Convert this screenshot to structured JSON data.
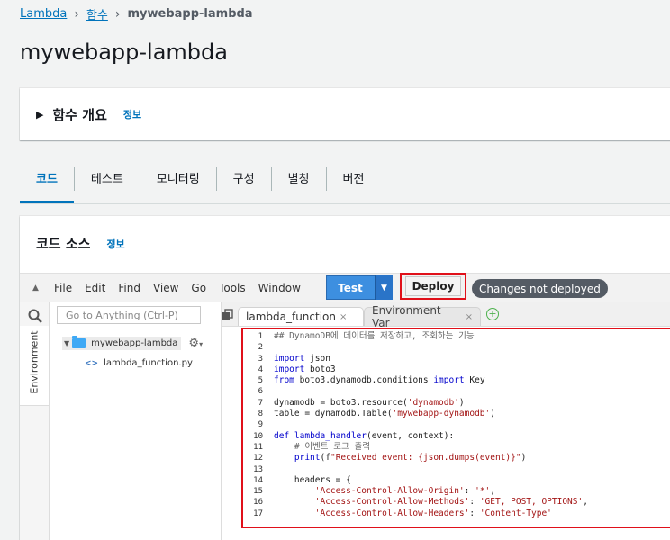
{
  "breadcrumb": {
    "root": "Lambda",
    "functions": "함수",
    "current": "mywebapp-lambda"
  },
  "page_title": "mywebapp-lambda",
  "overview": {
    "title": "함수 개요",
    "info": "정보"
  },
  "tabs": [
    {
      "label": "코드",
      "active": true
    },
    {
      "label": "테스트"
    },
    {
      "label": "모니터링"
    },
    {
      "label": "구성"
    },
    {
      "label": "별칭"
    },
    {
      "label": "버전"
    }
  ],
  "code_source": {
    "title": "코드 소스",
    "info": "정보"
  },
  "ide": {
    "menu": [
      "File",
      "Edit",
      "Find",
      "View",
      "Go",
      "Tools",
      "Window"
    ],
    "test_label": "Test",
    "deploy_label": "Deploy",
    "status_badge": "Changes not deployed",
    "goto_placeholder": "Go to Anything (Ctrl-P)",
    "environment_label": "Environment",
    "folder": "mywebapp-lambda",
    "file": "lambda_function.py",
    "editor_tabs": [
      "lambda_function",
      "Environment Var"
    ],
    "code_lines": [
      "## DynamoDB에 데이터를 저장하고, 조회하는 기능",
      "",
      "import json",
      "import boto3",
      "from boto3.dynamodb.conditions import Key",
      "",
      "dynamodb = boto3.resource('dynamodb')",
      "table = dynamodb.Table('mywebapp-dynamodb')",
      "",
      "def lambda_handler(event, context):",
      "    # 이벤트 로그 출력",
      "    print(f\"Received event: {json.dumps(event)}\")",
      "",
      "    headers = {",
      "        'Access-Control-Allow-Origin': '*',",
      "        'Access-Control-Allow-Methods': 'GET, POST, OPTIONS',",
      "        'Access-Control-Allow-Headers': 'Content-Type'"
    ]
  },
  "colors": {
    "link": "#0073bb",
    "highlight": "#e0101a",
    "test_button": "#3d8fe0",
    "badge": "#545b64"
  }
}
